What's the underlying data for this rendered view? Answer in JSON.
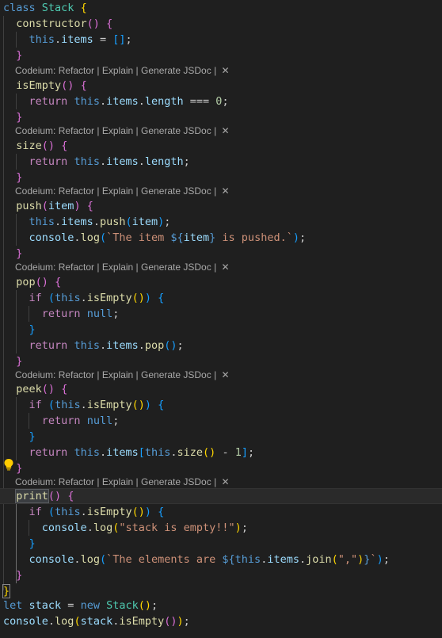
{
  "codelens": {
    "prefix": "Codeium: ",
    "refactor": "Refactor",
    "explain": "Explain",
    "generate_jsdoc": "Generate JSDoc",
    "sep": " | ",
    "close": "✕"
  },
  "code": {
    "class_kw": "class",
    "class_name": "Stack",
    "constructor": "constructor",
    "this": "this",
    "items": "items",
    "is_empty": "isEmpty",
    "return_kw": "return",
    "length": "length",
    "zero": "0",
    "one": "1",
    "size": "size",
    "push": "push",
    "item": "item",
    "console": "console",
    "log": "log",
    "tpl_item_before": "`The item ",
    "tpl_item_after": " is pushed.`",
    "pop": "pop",
    "if_kw": "if",
    "null_kw": "null",
    "peek": "peek",
    "print": "print",
    "join": "join",
    "str_empty": "\"stack is empty!!\"",
    "tpl_elements_before": "`The elements are ",
    "comma_str": "\",\"",
    "let_kw": "let",
    "stack": "stack",
    "new_kw": "new"
  }
}
